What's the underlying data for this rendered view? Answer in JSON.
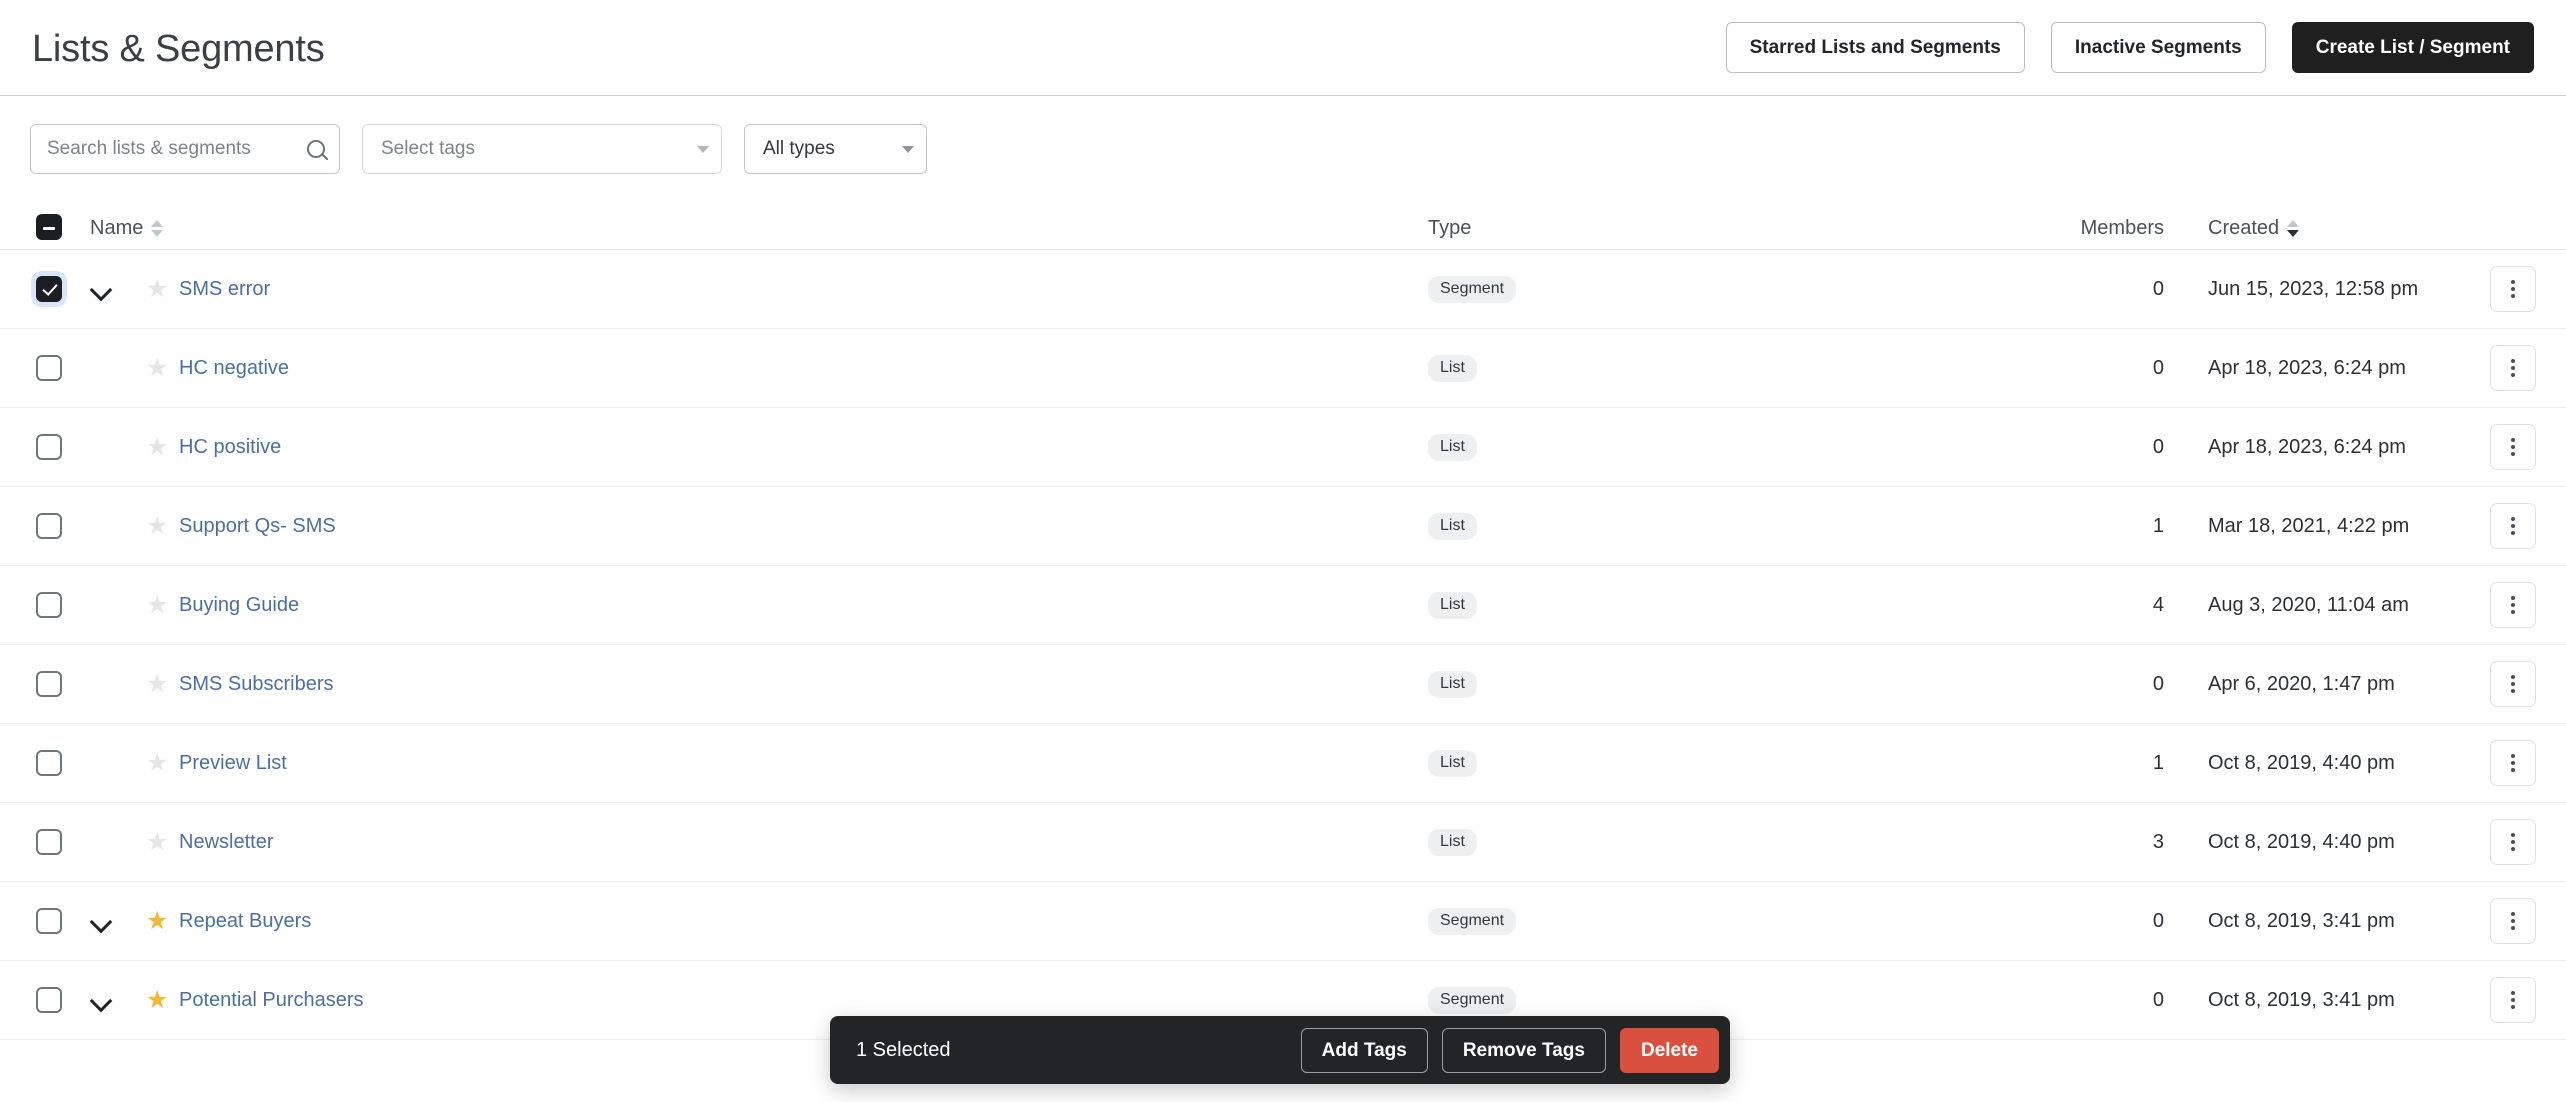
{
  "header": {
    "title": "Lists & Segments",
    "actions": [
      {
        "label": "Starred Lists and Segments",
        "style": "secondary"
      },
      {
        "label": "Inactive Segments",
        "style": "secondary"
      },
      {
        "label": "Create List / Segment",
        "style": "primary"
      }
    ]
  },
  "filters": {
    "search_placeholder": "Search lists & segments",
    "search_value": "",
    "tags_placeholder": "Select tags",
    "type_value": "All types"
  },
  "table": {
    "columns": {
      "name": "Name",
      "type": "Type",
      "members": "Members",
      "created": "Created"
    },
    "select_all_state": "indeterminate",
    "sort": {
      "column": "Created",
      "direction": "desc"
    },
    "rows": [
      {
        "name": "SMS error",
        "type": "Segment",
        "members": "0",
        "created": "Jun 15, 2023, 12:58 pm",
        "selected": true,
        "starred": false,
        "expandable": true
      },
      {
        "name": "HC negative",
        "type": "List",
        "members": "0",
        "created": "Apr 18, 2023, 6:24 pm",
        "selected": false,
        "starred": false,
        "expandable": false
      },
      {
        "name": "HC positive",
        "type": "List",
        "members": "0",
        "created": "Apr 18, 2023, 6:24 pm",
        "selected": false,
        "starred": false,
        "expandable": false
      },
      {
        "name": "Support Qs- SMS",
        "type": "List",
        "members": "1",
        "created": "Mar 18, 2021, 4:22 pm",
        "selected": false,
        "starred": false,
        "expandable": false
      },
      {
        "name": "Buying Guide",
        "type": "List",
        "members": "4",
        "created": "Aug 3, 2020, 11:04 am",
        "selected": false,
        "starred": false,
        "expandable": false
      },
      {
        "name": "SMS Subscribers",
        "type": "List",
        "members": "0",
        "created": "Apr 6, 2020, 1:47 pm",
        "selected": false,
        "starred": false,
        "expandable": false
      },
      {
        "name": "Preview List",
        "type": "List",
        "members": "1",
        "created": "Oct 8, 2019, 4:40 pm",
        "selected": false,
        "starred": false,
        "expandable": false
      },
      {
        "name": "Newsletter",
        "type": "List",
        "members": "3",
        "created": "Oct 8, 2019, 4:40 pm",
        "selected": false,
        "starred": false,
        "expandable": false
      },
      {
        "name": "Repeat Buyers",
        "type": "Segment",
        "members": "0",
        "created": "Oct 8, 2019, 3:41 pm",
        "selected": false,
        "starred": true,
        "expandable": true
      },
      {
        "name": "Potential Purchasers",
        "type": "Segment",
        "members": "0",
        "created": "Oct 8, 2019, 3:41 pm",
        "selected": false,
        "starred": true,
        "expandable": true
      }
    ]
  },
  "action_bar": {
    "selected_label": "1 Selected",
    "add_tags_label": "Add Tags",
    "remove_tags_label": "Remove Tags",
    "delete_label": "Delete"
  },
  "icons": {
    "search": "search-icon",
    "star": "★",
    "kebab": "kebab-menu-icon",
    "chevron_down": "chevron-down-icon"
  },
  "colors": {
    "link": "#4a6fa5",
    "star_on": "#f5b638",
    "danger": "#d9503f",
    "primary": "#1f1f1f"
  }
}
